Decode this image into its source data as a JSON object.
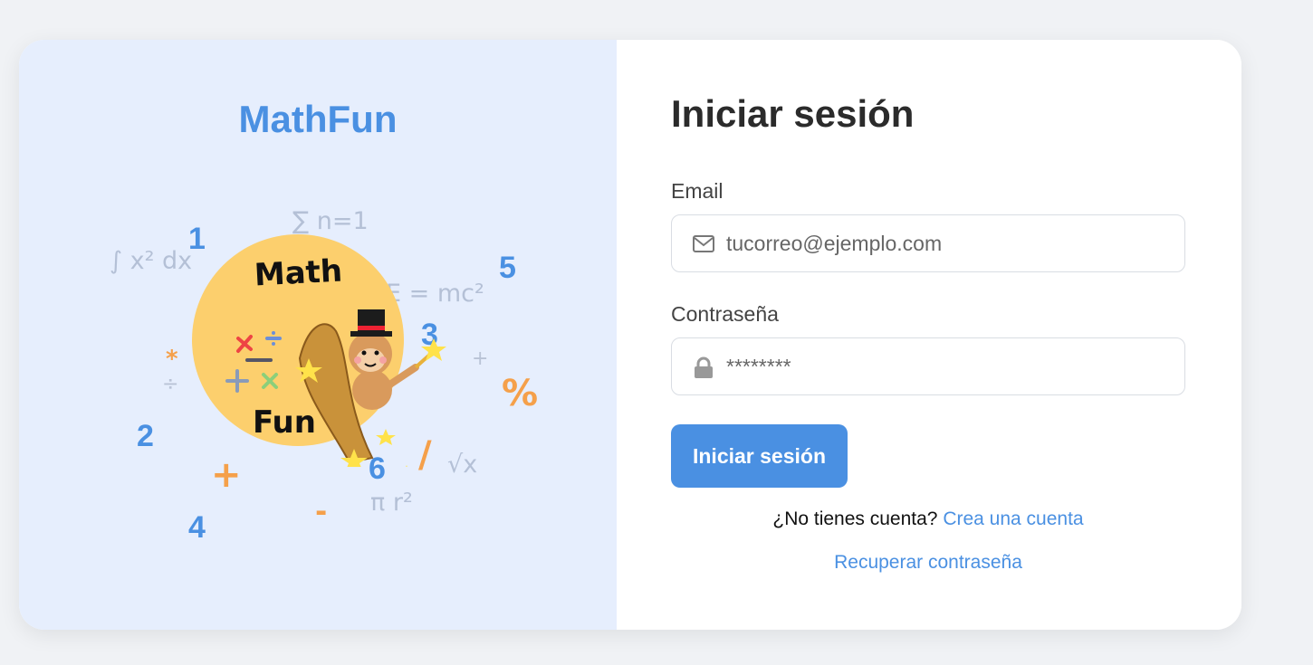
{
  "brand": {
    "name": "MathFun"
  },
  "illustration": {
    "formulas": [
      "∑ n=1",
      "∫ x² dx",
      "E = mc²",
      "√x",
      "π r²"
    ],
    "numbers": [
      "1",
      "2",
      "3",
      "4",
      "5",
      "6"
    ],
    "operators": [
      "*",
      "÷",
      "+",
      "%",
      "+",
      "/",
      "-"
    ],
    "logo_text_top": "Math",
    "logo_text_bottom": "Fun"
  },
  "login": {
    "title": "Iniciar sesión",
    "email_label": "Email",
    "email_placeholder": "tucorreo@ejemplo.com",
    "password_label": "Contraseña",
    "password_placeholder": "********",
    "submit_label": "Iniciar sesión",
    "no_account_text": "¿No tienes cuenta?",
    "register_link": "Crea una cuenta",
    "recover_link": "Recuperar contraseña"
  },
  "icons": {
    "email": "envelope-icon",
    "password": "lock-icon"
  },
  "colors": {
    "accent": "#4a90e2",
    "left_panel_bg": "#e6eefd",
    "page_bg": "#f0f2f5",
    "orange": "#f5a04a",
    "logo_circle": "#fccf6d"
  }
}
